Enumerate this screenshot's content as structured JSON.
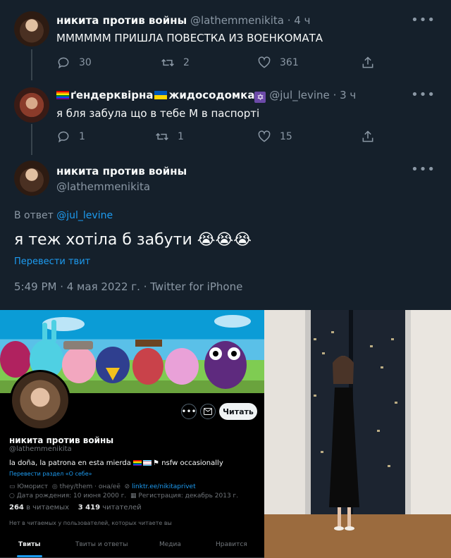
{
  "tweets": [
    {
      "name": "никита против войны",
      "handle": "@lathemmenikita",
      "time": "· 4 ч",
      "text": "ММММММ ПРИШЛА ПОВЕСТКА ИЗ ВОЕНКОМАТА",
      "replies": "30",
      "retweets": "2",
      "likes": "361"
    },
    {
      "name_part1": "ґендерквірна",
      "name_part2": "жидосодомка",
      "handle": "@jul_levine",
      "time": "· 3 ч",
      "text": "я бля забула що в тебе М в паспорті",
      "replies": "1",
      "retweets": "1",
      "likes": "15"
    }
  ],
  "main_tweet": {
    "name": "никита против войны",
    "handle": "@lathemmenikita",
    "reply_prefix": "В ответ",
    "reply_to": "@jul_levine",
    "text": "я теж хотіла б забути",
    "emojis": "😭😭😭",
    "translate": "Перевести твит",
    "timestamp": "5:49 PM · 4 мая 2022 г. · Twitter for iPhone"
  },
  "profile": {
    "name": "никита против войны",
    "handle": "@lathemmenikita",
    "bio_start": "la doña, la patrona en esta mierda",
    "bio_end": "nsfw occasionally",
    "translate_bio": "Перевести раздел «О себе»",
    "category": "Юморист",
    "pronouns": "they/them · она/её",
    "link": "linktr.ee/nikitaprivet",
    "birthday": "Дата рождения: 10 июня 2000 г.",
    "joined": "Регистрация: декабрь 2013 г.",
    "following_count": "264",
    "following_label": "в читаемых",
    "followers_count": "3 419",
    "followers_label": "читателей",
    "note": "Нет в читаемых у пользователей, которых читаете вы",
    "read_button": "Читать",
    "tabs": [
      "Твиты",
      "Твиты и ответы",
      "Медиа",
      "Нравится"
    ]
  },
  "colors": {
    "background": "#15202b",
    "accent": "#1d9bf0",
    "muted": "#8b98a5",
    "profile_bg": "#000000"
  },
  "icons": [
    "reply-icon",
    "retweet-icon",
    "like-icon",
    "share-icon",
    "more-icon",
    "mail-icon",
    "briefcase-icon",
    "link-icon",
    "balloon-icon",
    "calendar-icon"
  ]
}
